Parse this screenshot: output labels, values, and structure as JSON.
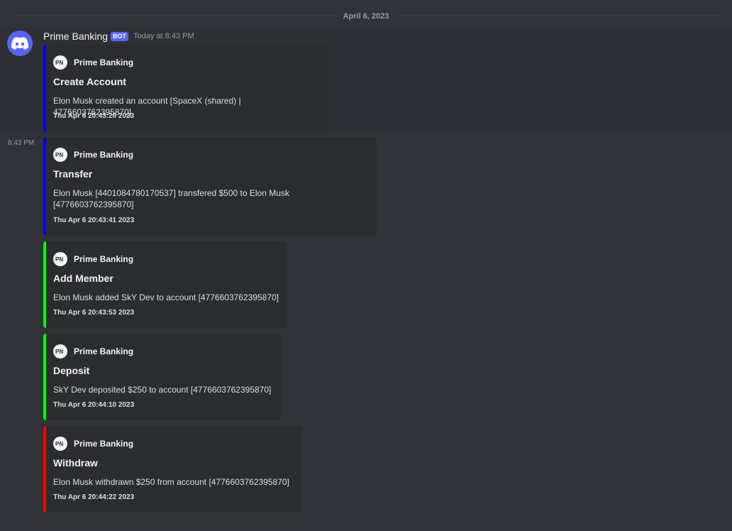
{
  "date_divider": "April 6, 2023",
  "message": {
    "username": "Prime Banking",
    "bot_tag": "BOT",
    "timestamp": "Today at 8:43 PM",
    "side_timestamp": "8:43 PM",
    "avatar_icon": "discord-logo-icon"
  },
  "embeds": [
    {
      "author": "Prime Banking",
      "title": "Create Account",
      "description": "Elon Musk created an account [SpaceX (shared) | 4776603762395870]",
      "footer": "Thu Apr  6 20:43:28 2023",
      "color": "#0000ff"
    },
    {
      "author": "Prime Banking",
      "title": "Transfer",
      "description": "Elon Musk [4401084780170537] transfered $500 to Elon Musk [4776603762395870]",
      "footer": "Thu Apr  6 20:43:41 2023",
      "color": "#0000ff"
    },
    {
      "author": "Prime Banking",
      "title": "Add Member",
      "description": "Elon Musk added SkY Dev to account [4776603762395870]",
      "footer": "Thu Apr  6 20:43:53 2023",
      "color": "#00ff00"
    },
    {
      "author": "Prime Banking",
      "title": "Deposit",
      "description": "SkY Dev deposited $250 to account [4776603762395870]",
      "footer": "Thu Apr  6 20:44:10 2023",
      "color": "#00ff00"
    },
    {
      "author": "Prime Banking",
      "title": "Withdraw",
      "description": "Elon Musk withdrawn $250 from account [4776603762395870]",
      "footer": "Thu Apr  6 20:44:22 2023",
      "color": "#ff0000"
    }
  ]
}
